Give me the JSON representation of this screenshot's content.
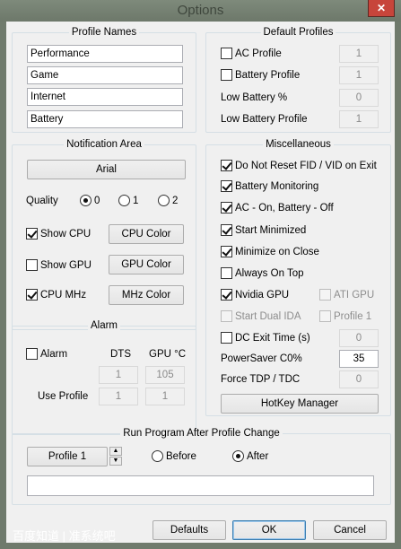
{
  "window": {
    "title": "Options",
    "close_glyph": "✕"
  },
  "profile_names": {
    "title": "Profile Names",
    "names": [
      "Performance",
      "Game",
      "Internet",
      "Battery"
    ]
  },
  "default_profiles": {
    "title": "Default Profiles",
    "ac_profile": {
      "label": "AC Profile",
      "checked": false,
      "value": "1"
    },
    "battery_profile": {
      "label": "Battery Profile",
      "checked": false,
      "value": "1"
    },
    "low_battery_pct": {
      "label": "Low Battery %",
      "value": "0"
    },
    "low_battery_profile": {
      "label": "Low Battery Profile",
      "value": "1"
    }
  },
  "notification_area": {
    "title": "Notification Area",
    "font_button": "Arial",
    "quality_label": "Quality",
    "quality_options": [
      "0",
      "1",
      "2"
    ],
    "quality_selected": "0",
    "show_cpu": {
      "label": "Show CPU",
      "checked": true
    },
    "show_gpu": {
      "label": "Show GPU",
      "checked": false
    },
    "cpu_mhz": {
      "label": "CPU MHz",
      "checked": true
    },
    "cpu_color_button": "CPU Color",
    "gpu_color_button": "GPU Color",
    "mhz_color_button": "MHz Color"
  },
  "alarm": {
    "title": "Alarm",
    "alarm_label": "Alarm",
    "alarm_checked": false,
    "dts_label": "DTS",
    "gpu_label": "GPU °C",
    "dts_value": "1",
    "gpu_value": "105",
    "use_profile_label": "Use Profile",
    "use_profile_dts": "1",
    "use_profile_gpu": "1"
  },
  "misc": {
    "title": "Miscellaneous",
    "do_not_reset": {
      "label": "Do Not Reset FID / VID on Exit",
      "checked": true
    },
    "battery_monitoring": {
      "label": "Battery Monitoring",
      "checked": true
    },
    "ac_on_battery_off": {
      "label": "AC - On, Battery - Off",
      "checked": true
    },
    "start_minimized": {
      "label": "Start Minimized",
      "checked": true
    },
    "minimize_on_close": {
      "label": "Minimize on Close",
      "checked": true
    },
    "always_on_top": {
      "label": "Always On Top",
      "checked": false
    },
    "nvidia_gpu": {
      "label": "Nvidia GPU",
      "checked": true
    },
    "ati_gpu": {
      "label": "ATI GPU",
      "checked": false
    },
    "start_dual_ida": {
      "label": "Start Dual IDA",
      "checked": false
    },
    "profile_1": {
      "label": "Profile 1",
      "checked": false
    },
    "dc_exit_time": {
      "label": "DC Exit Time (s)",
      "checked": false,
      "value": "0"
    },
    "powersaver": {
      "label": "PowerSaver C0%",
      "value": "35"
    },
    "force_tdp": {
      "label": "Force TDP / TDC",
      "value": "0"
    },
    "hotkey_button": "HotKey Manager"
  },
  "run_program": {
    "title": "Run Program After Profile Change",
    "profile_button": "Profile 1",
    "spin_up": "▲",
    "spin_down": "▼",
    "before_label": "Before",
    "after_label": "After",
    "selected": "After",
    "path_value": ""
  },
  "buttons": {
    "defaults": "Defaults",
    "ok": "OK",
    "cancel": "Cancel"
  },
  "watermark": "百度知道 | 准系统吧"
}
